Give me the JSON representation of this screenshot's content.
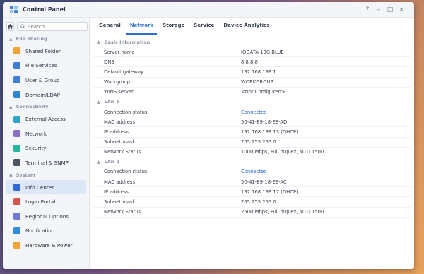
{
  "window": {
    "title": "Control Panel",
    "controls": [
      "?",
      "–",
      "□",
      "×"
    ]
  },
  "sidebar": {
    "search_placeholder": "Search",
    "sections": [
      {
        "title": "File Sharing",
        "items": [
          {
            "label": "Shared Folder",
            "icon": "folder-icon",
            "color": "#f0a33a"
          },
          {
            "label": "File Services",
            "icon": "file-services-icon",
            "color": "#3b7fd9"
          },
          {
            "label": "User & Group",
            "icon": "user-group-icon",
            "color": "#3b7fd9"
          },
          {
            "label": "Domain/LDAP",
            "icon": "domain-icon",
            "color": "#2f86d6"
          }
        ]
      },
      {
        "title": "Connectivity",
        "items": [
          {
            "label": "External Access",
            "icon": "globe-icon",
            "color": "#2aa6c9"
          },
          {
            "label": "Network",
            "icon": "house-network-icon",
            "color": "#8a6fc8"
          },
          {
            "label": "Security",
            "icon": "shield-icon",
            "color": "#2bb3a0"
          },
          {
            "label": "Terminal & SNMP",
            "icon": "terminal-icon",
            "color": "#4b5563"
          }
        ]
      },
      {
        "title": "System",
        "items": [
          {
            "label": "Info Center",
            "icon": "info-icon",
            "color": "#2e6bd6",
            "active": true
          },
          {
            "label": "Login Portal",
            "icon": "login-portal-icon",
            "color": "#d9534f"
          },
          {
            "label": "Regional Options",
            "icon": "regional-icon",
            "color": "#6c7bd8"
          },
          {
            "label": "Notification",
            "icon": "notification-icon",
            "color": "#2e8de0"
          },
          {
            "label": "Hardware & Power",
            "icon": "bulb-icon",
            "color": "#f0a33a"
          }
        ]
      }
    ]
  },
  "tabs": [
    {
      "label": "General"
    },
    {
      "label": "Network",
      "active": true
    },
    {
      "label": "Storage"
    },
    {
      "label": "Service"
    },
    {
      "label": "Device Analytics"
    }
  ],
  "groups": [
    {
      "title": "Basic Information",
      "rows": [
        {
          "key": "Server name",
          "value": "IODATA-10G-BLUE"
        },
        {
          "key": "DNS",
          "value": "8.8.8.8"
        },
        {
          "key": "Default gateway",
          "value": "192.168.199.1"
        },
        {
          "key": "Workgroup",
          "value": "WORKGROUP"
        },
        {
          "key": "WINS server",
          "value": "<Not Configured>"
        }
      ]
    },
    {
      "title": "LAN 1",
      "rows": [
        {
          "key": "Connection status",
          "value": "Connected",
          "link": true
        },
        {
          "key": "MAC address",
          "value": "50-41-B9-18-EE-AD"
        },
        {
          "key": "IP address",
          "value": "192.168.199.13 (DHCP)"
        },
        {
          "key": "Subnet mask",
          "value": "255.255.255.0"
        },
        {
          "key": "Network Status",
          "value": "1000 Mbps, Full duplex, MTU 1500"
        }
      ]
    },
    {
      "title": "LAN 2",
      "rows": [
        {
          "key": "Connection status",
          "value": "Connected",
          "link": true
        },
        {
          "key": "MAC address",
          "value": "50-41-B9-18-EE-AC"
        },
        {
          "key": "IP address",
          "value": "192.168.199.17 (DHCP)"
        },
        {
          "key": "Subnet mask",
          "value": "255.255.255.0"
        },
        {
          "key": "Network Status",
          "value": "2500 Mbps, Full duplex, MTU 1500"
        }
      ]
    }
  ]
}
